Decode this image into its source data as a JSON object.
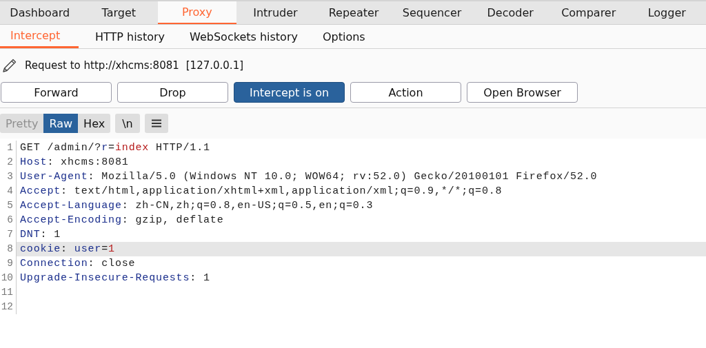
{
  "main_tabs": [
    {
      "label": "Dashboard",
      "selected": false
    },
    {
      "label": "Target",
      "selected": false
    },
    {
      "label": "Proxy",
      "selected": true
    },
    {
      "label": "Intruder",
      "selected": false
    },
    {
      "label": "Repeater",
      "selected": false
    },
    {
      "label": "Sequencer",
      "selected": false
    },
    {
      "label": "Decoder",
      "selected": false
    },
    {
      "label": "Comparer",
      "selected": false
    },
    {
      "label": "Logger",
      "selected": false
    }
  ],
  "sub_tabs": [
    {
      "label": "Intercept",
      "selected": true
    },
    {
      "label": "HTTP history",
      "selected": false
    },
    {
      "label": "WebSockets history",
      "selected": false
    },
    {
      "label": "Options",
      "selected": false
    }
  ],
  "request_info": {
    "title": "Request to http://xhcms:8081",
    "address": "[127.0.0.1]"
  },
  "buttons": [
    {
      "label": "Forward",
      "on": false
    },
    {
      "label": "Drop",
      "on": false
    },
    {
      "label": "Intercept is on",
      "on": true
    },
    {
      "label": "Action",
      "on": false
    },
    {
      "label": "Open Browser",
      "on": false
    }
  ],
  "view_tabs": [
    {
      "label": "Pretty",
      "selected": false,
      "disabled": true
    },
    {
      "label": "Raw",
      "selected": true,
      "disabled": false
    },
    {
      "label": "Hex",
      "selected": false,
      "disabled": false
    }
  ],
  "view_buttons": [
    {
      "label": "\\n",
      "kind": "text"
    },
    {
      "kind": "menu"
    }
  ],
  "editor_lines": [
    {
      "number": "1",
      "highlighted": false,
      "segments": [
        {
          "kind": "plain",
          "text": "GET /admin/?"
        },
        {
          "kind": "key",
          "text": "r"
        },
        {
          "kind": "plain",
          "text": "="
        },
        {
          "kind": "value",
          "text": "index"
        },
        {
          "kind": "plain",
          "text": " HTTP/1.1"
        }
      ]
    },
    {
      "number": "2",
      "highlighted": false,
      "segments": [
        {
          "kind": "key",
          "text": "Host"
        },
        {
          "kind": "plain",
          "text": ": xhcms:8081"
        }
      ]
    },
    {
      "number": "3",
      "highlighted": false,
      "segments": [
        {
          "kind": "key",
          "text": "User-Agent"
        },
        {
          "kind": "plain",
          "text": ": Mozilla/5.0 (Windows NT 10.0; WOW64; rv:52.0) Gecko/20100101 Firefox/52.0"
        }
      ]
    },
    {
      "number": "4",
      "highlighted": false,
      "segments": [
        {
          "kind": "key",
          "text": "Accept"
        },
        {
          "kind": "plain",
          "text": ": text/html,application/xhtml+xml,application/xml;q=0.9,*/*;q=0.8"
        }
      ]
    },
    {
      "number": "5",
      "highlighted": false,
      "segments": [
        {
          "kind": "key",
          "text": "Accept-Language"
        },
        {
          "kind": "plain",
          "text": ": zh-CN,zh;q=0.8,en-US;q=0.5,en;q=0.3"
        }
      ]
    },
    {
      "number": "6",
      "highlighted": false,
      "segments": [
        {
          "kind": "key",
          "text": "Accept-Encoding"
        },
        {
          "kind": "plain",
          "text": ": gzip, deflate"
        }
      ]
    },
    {
      "number": "7",
      "highlighted": false,
      "segments": [
        {
          "kind": "key",
          "text": "DNT"
        },
        {
          "kind": "plain",
          "text": ": 1"
        }
      ]
    },
    {
      "number": "8",
      "highlighted": true,
      "segments": [
        {
          "kind": "key",
          "text": "cookie"
        },
        {
          "kind": "plain",
          "text": ": "
        },
        {
          "kind": "key",
          "text": "user"
        },
        {
          "kind": "plain",
          "text": "="
        },
        {
          "kind": "value",
          "text": "1"
        }
      ]
    },
    {
      "number": "9",
      "highlighted": false,
      "segments": [
        {
          "kind": "key",
          "text": "Connection"
        },
        {
          "kind": "plain",
          "text": ": close"
        }
      ]
    },
    {
      "number": "10",
      "highlighted": false,
      "segments": [
        {
          "kind": "key",
          "text": "Upgrade-Insecure-Requests"
        },
        {
          "kind": "plain",
          "text": ": 1"
        }
      ]
    },
    {
      "number": "11",
      "highlighted": false
    },
    {
      "number": "12",
      "highlighted": false
    }
  ]
}
